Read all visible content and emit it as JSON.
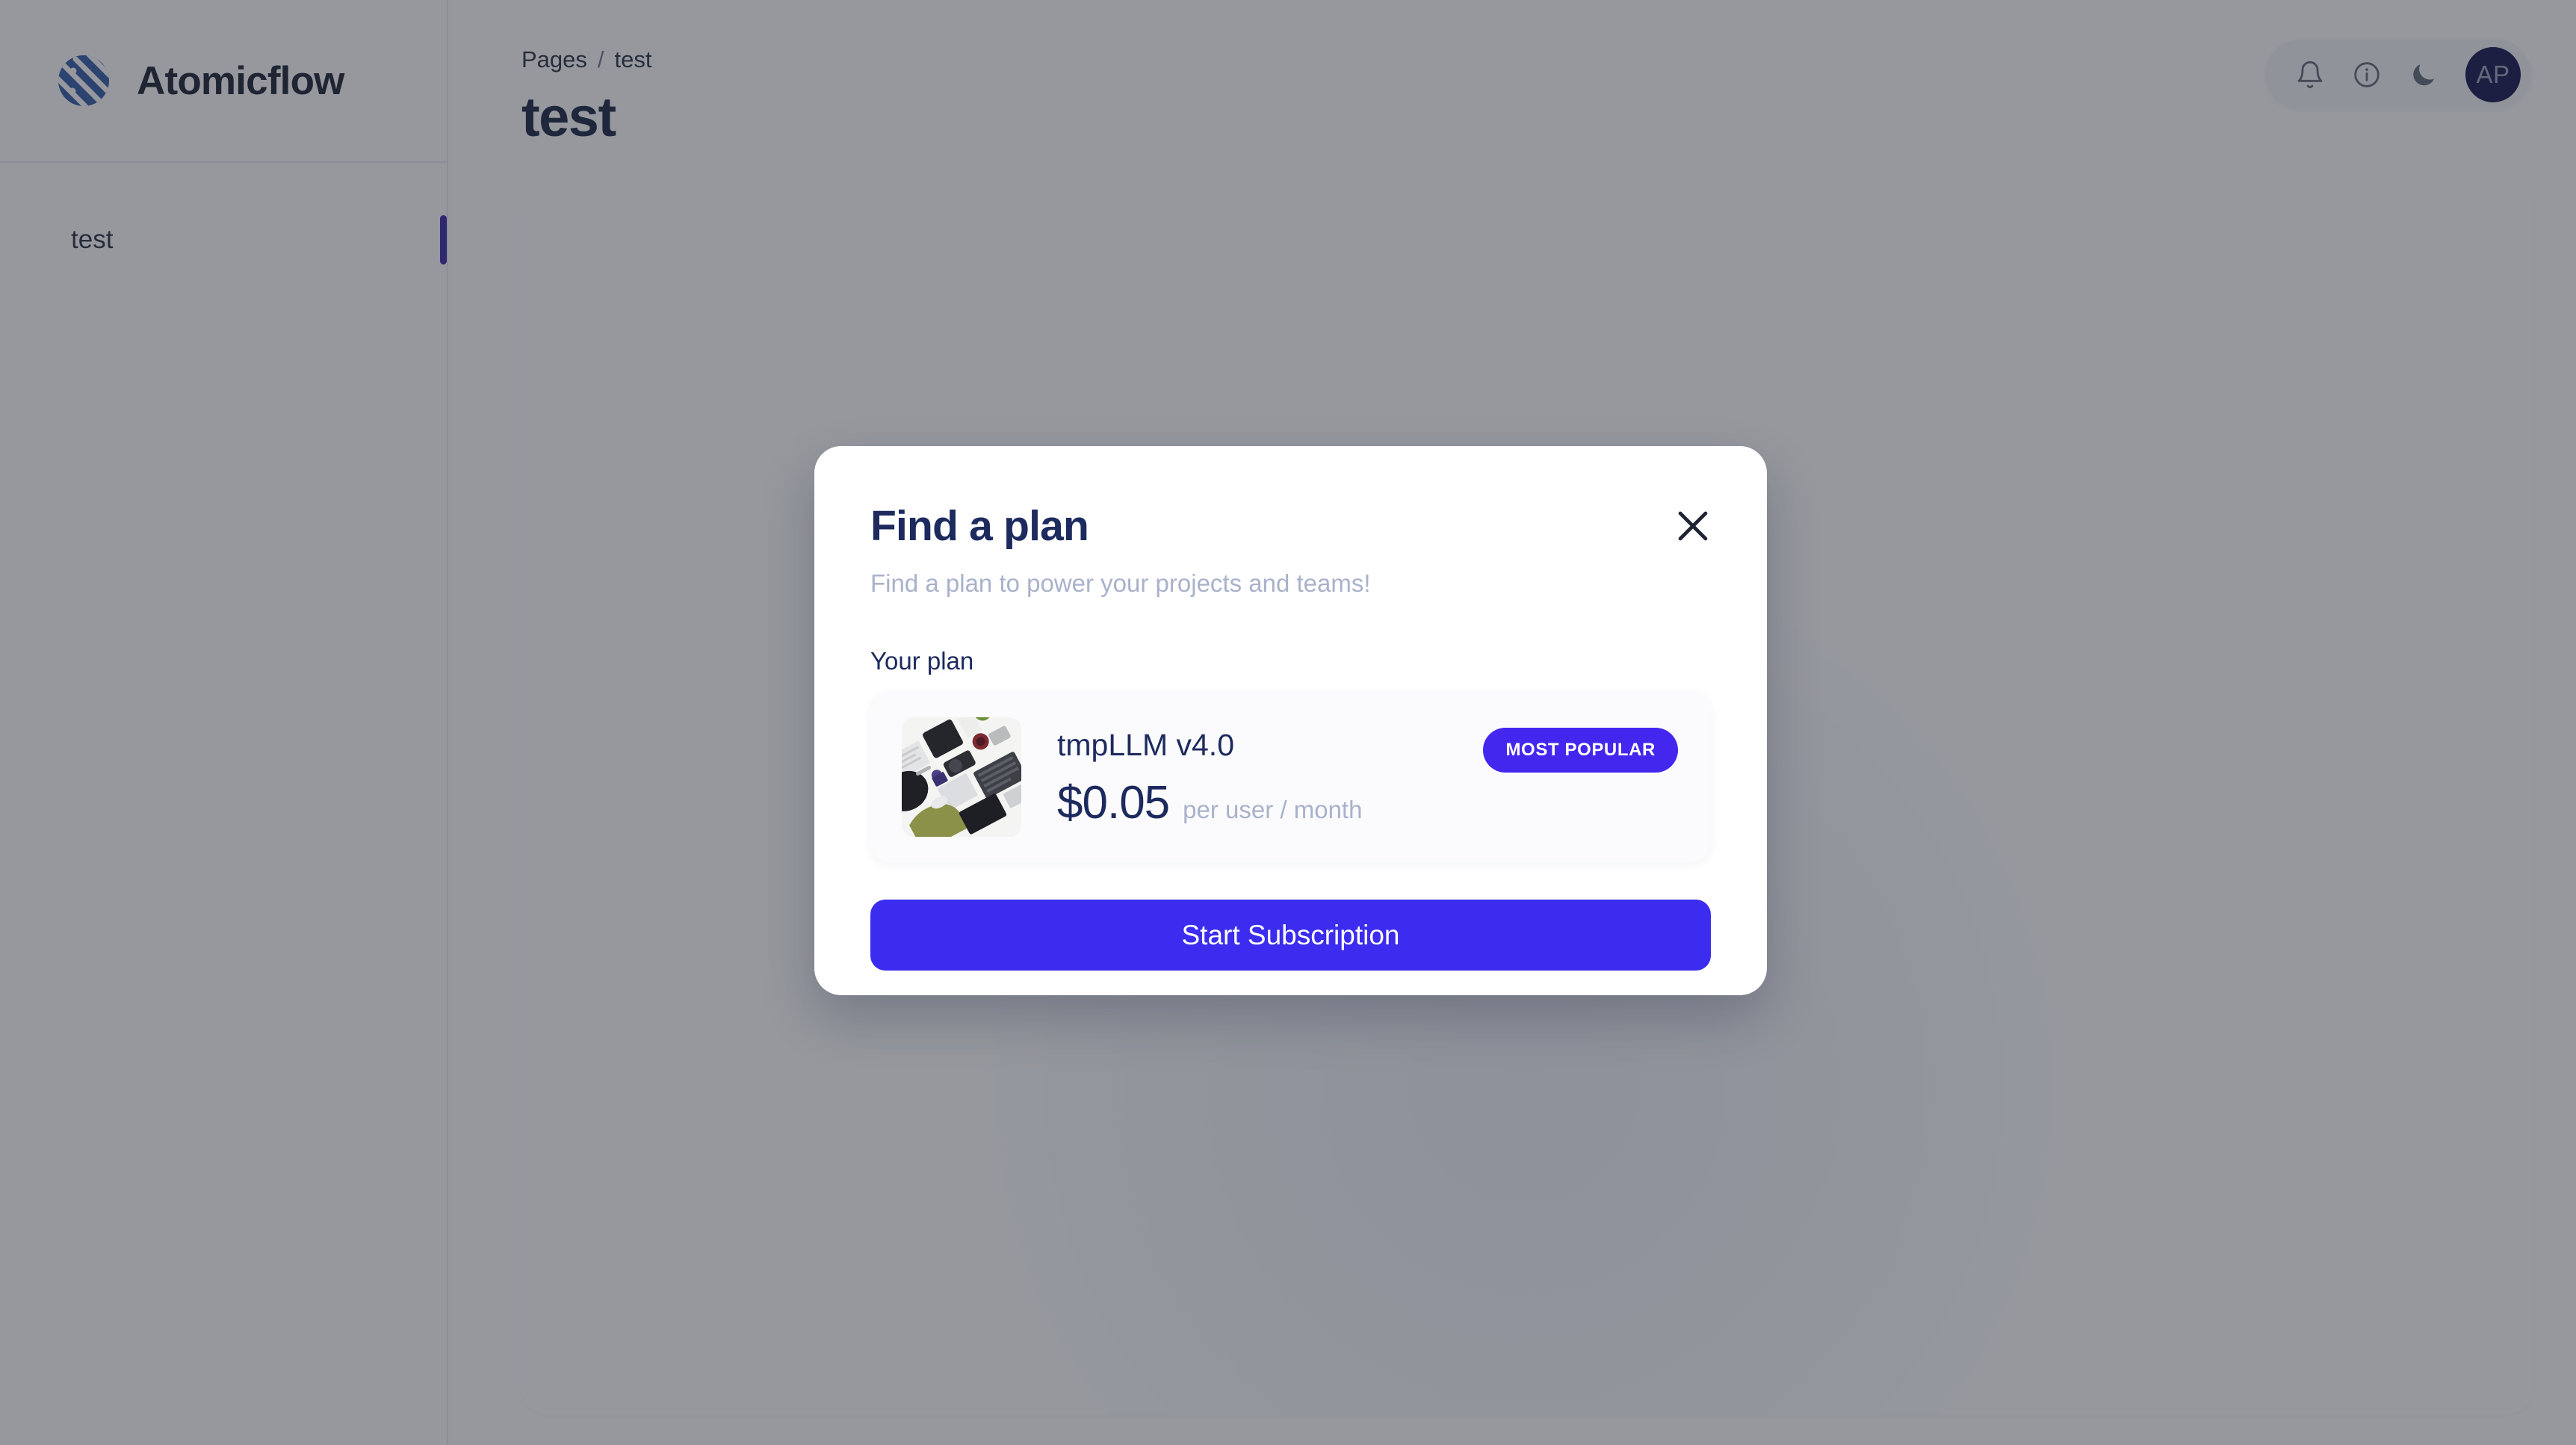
{
  "sidebar": {
    "brand": {
      "name": "Atomicflow",
      "logo_icon": "atomicflow-globe-logo"
    },
    "items": [
      {
        "label": "test",
        "active": true
      }
    ]
  },
  "header": {
    "breadcrumb": {
      "root": "Pages",
      "separator": "/",
      "current": "test"
    },
    "page_title": "test",
    "actions": [
      {
        "icon": "bell-icon",
        "name": "notifications"
      },
      {
        "icon": "info-circle-icon",
        "name": "help"
      },
      {
        "icon": "moon-icon",
        "name": "dark-mode-toggle"
      }
    ],
    "avatar": {
      "initials": "AP"
    }
  },
  "modal": {
    "title": "Find a plan",
    "subtitle": "Find a plan to power your projects and teams!",
    "close_icon": "close-x-icon",
    "section_label": "Your plan",
    "plan": {
      "name": "tmpLLM v4.0",
      "price": "$0.05",
      "period": "per user / month",
      "badge": "MOST POPULAR",
      "thumbnail_icon": "desk-flatlay-photo"
    },
    "cta_label": "Start Subscription"
  },
  "colors": {
    "accent_purple": "#3b2cef",
    "badge_purple": "#4327ef",
    "active_bar": "#2e1f9e",
    "title_navy": "#1d2a5e",
    "muted_text": "#a9b2cb",
    "avatar_bg": "#0a0a47",
    "logo_blue": "#2b54a0",
    "overlay": "rgba(45,50,62,.50)"
  }
}
